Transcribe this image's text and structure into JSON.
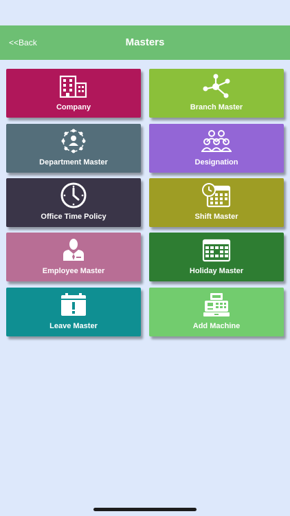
{
  "header": {
    "back_label": "<<Back",
    "title": "Masters",
    "color": "#6dbf73"
  },
  "tiles": [
    {
      "label": "Company",
      "icon": "building-icon",
      "color": "#b0175a"
    },
    {
      "label": "Branch Master",
      "icon": "branch-network-icon",
      "color": "#8bc03a"
    },
    {
      "label": "Department Master",
      "icon": "department-network-icon",
      "color": "#546e7a"
    },
    {
      "label": "Designation",
      "icon": "group-icon",
      "color": "#9366d6"
    },
    {
      "label": "Office Time Policy",
      "icon": "clock-icon",
      "color": "#3a3548"
    },
    {
      "label": "Shift Master",
      "icon": "calendar-clock-icon",
      "color": "#9e9d24"
    },
    {
      "label": "Employee Master",
      "icon": "employee-icon",
      "color": "#b86e95"
    },
    {
      "label": "Holiday Master",
      "icon": "calendar-icon",
      "color": "#2e7d32"
    },
    {
      "label": "Leave Master",
      "icon": "calendar-alert-icon",
      "color": "#0f8f92"
    },
    {
      "label": "Add Machine",
      "icon": "cash-register-icon",
      "color": "#72cc6e"
    }
  ]
}
